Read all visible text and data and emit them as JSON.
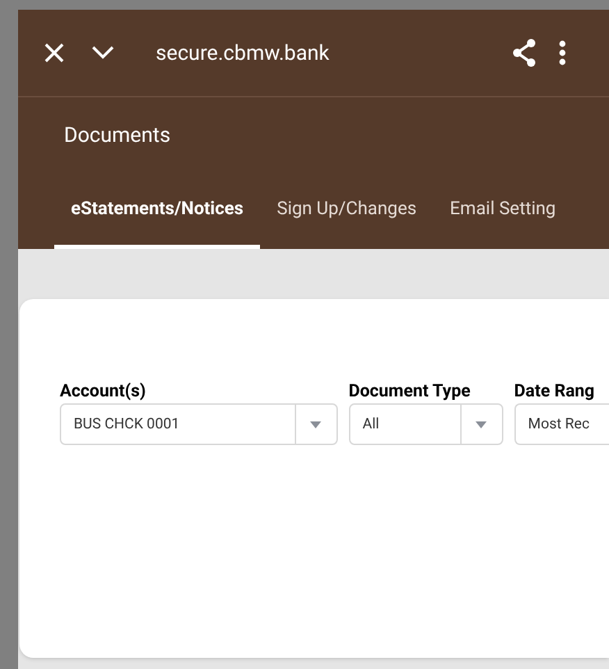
{
  "browser_bar": {
    "url": "secure.cbmw.bank"
  },
  "header": {
    "title": "Documents"
  },
  "tabs": [
    {
      "label": "eStatements/Notices",
      "selected": true
    },
    {
      "label": "Sign Up/Changes",
      "selected": false
    },
    {
      "label": "Email Setting",
      "selected": false
    }
  ],
  "filters": [
    {
      "label": "Account(s)",
      "value": "BUS CHCK 0001",
      "kind": "dropdown"
    },
    {
      "label": "Document Type",
      "value": "All",
      "kind": "dropdown"
    },
    {
      "label": "Date Rang",
      "value": "Most Rec",
      "kind": "cut"
    }
  ]
}
